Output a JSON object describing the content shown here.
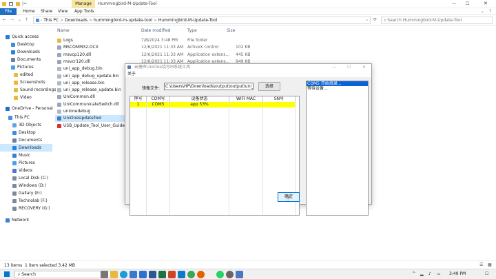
{
  "titlebar": {
    "ribbon_context": "Manage",
    "title": "Hummingbird-M-Update-Tool",
    "quick_access": "|="
  },
  "ribbon": {
    "tabs": [
      "File",
      "Home",
      "Share",
      "View",
      "App Tools"
    ]
  },
  "address": {
    "crumbs": [
      "This PC",
      ">",
      "Downloads",
      ">",
      "hummingbird-m-update-tool",
      ">",
      "Hummingbird-M-Update-Tool"
    ],
    "search_placeholder": "Search Hummingbird-M-Update-Tool"
  },
  "nav": {
    "items": [
      {
        "label": "Quick access",
        "icon": "star-icon",
        "color": "#2b7bd5"
      },
      {
        "label": "Desktop",
        "icon": "desktop-icon",
        "color": "#3a8ee6"
      },
      {
        "label": "Downloads",
        "icon": "download-icon",
        "color": "#2f7fd8"
      },
      {
        "label": "Documents",
        "icon": "documents-icon",
        "color": "#6e7f99"
      },
      {
        "label": "Pictures",
        "icon": "pictures-icon",
        "color": "#4aa0e8"
      },
      {
        "label": "edited",
        "icon": "folder-icon",
        "color": "#e8b93c"
      },
      {
        "label": "Screenshots",
        "icon": "folder-icon",
        "color": "#e8b93c"
      },
      {
        "label": "Sound recordings",
        "icon": "folder-icon",
        "color": "#e8b93c"
      },
      {
        "label": "Video",
        "icon": "folder-icon",
        "color": "#e8b93c"
      },
      {
        "label": "OneDrive - Personal",
        "icon": "cloud-icon",
        "color": "#1d6fd1"
      },
      {
        "label": "This PC",
        "icon": "computer-icon",
        "color": "#4a8fd8"
      },
      {
        "label": "3D Objects",
        "icon": "cube-icon",
        "color": "#5aa6e8"
      },
      {
        "label": "Desktop",
        "icon": "desktop-icon",
        "color": "#3a8ee6"
      },
      {
        "label": "Documents",
        "icon": "documents-icon",
        "color": "#6e7f99"
      },
      {
        "label": "Downloads",
        "icon": "download-icon",
        "color": "#2f7fd8"
      },
      {
        "label": "Music",
        "icon": "music-icon",
        "color": "#3a7fd0"
      },
      {
        "label": "Pictures",
        "icon": "pictures-icon",
        "color": "#4aa0e8"
      },
      {
        "label": "Videos",
        "icon": "video-icon",
        "color": "#5a6fd0"
      },
      {
        "label": "Local Disk (C:)",
        "icon": "drive-icon",
        "color": "#7c8aa0"
      },
      {
        "label": "Windows (D:)",
        "icon": "drive-icon",
        "color": "#7c8aa0"
      },
      {
        "label": "Gallary (E:)",
        "icon": "drive-icon",
        "color": "#7c8aa0"
      },
      {
        "label": "Technolab (F:)",
        "icon": "drive-icon",
        "color": "#7c8aa0"
      },
      {
        "label": "RECOVERY (G:)",
        "icon": "drive-icon",
        "color": "#7c8aa0"
      },
      {
        "label": "Network",
        "icon": "network-icon",
        "color": "#3a7fd0"
      }
    ]
  },
  "files": {
    "headers": {
      "name": "Name",
      "date": "Date modified",
      "type": "Type",
      "size": "Size"
    },
    "rows": [
      {
        "name": "Logs",
        "date": "7/8/2024 3:48 PM",
        "type": "File folder",
        "size": "",
        "icon": "folder-icon",
        "color": "#e8b93c"
      },
      {
        "name": "MSCOMM32.OCX",
        "date": "12/6/2021 11:33 AM",
        "type": "ActiveX control",
        "size": "102 KB",
        "icon": "file-icon",
        "color": "#9aa6b8"
      },
      {
        "name": "msvcp120.dll",
        "date": "12/6/2021 11:33 AM",
        "type": "Application extens...",
        "size": "445 KB",
        "icon": "dll-icon",
        "color": "#9aa6b8"
      },
      {
        "name": "msvcr120.dll",
        "date": "12/6/2021 11:33 AM",
        "type": "Application extens...",
        "size": "949 KB",
        "icon": "dll-icon",
        "color": "#9aa6b8"
      },
      {
        "name": "uni_app_debug.bin",
        "date": "",
        "type": "",
        "size": "",
        "icon": "file-icon",
        "color": "#b0b8c6"
      },
      {
        "name": "uni_app_debug_update.bin",
        "date": "",
        "type": "",
        "size": "",
        "icon": "file-icon",
        "color": "#b0b8c6"
      },
      {
        "name": "uni_app_release.bin",
        "date": "",
        "type": "",
        "size": "",
        "icon": "file-icon",
        "color": "#b0b8c6"
      },
      {
        "name": "uni_app_release_update.bin",
        "date": "",
        "type": "",
        "size": "",
        "icon": "file-icon",
        "color": "#b0b8c6"
      },
      {
        "name": "UniCommon.dll",
        "date": "",
        "type": "",
        "size": "",
        "icon": "dll-icon",
        "color": "#9aa6b8"
      },
      {
        "name": "UniCommunicateSwitch.dll",
        "date": "",
        "type": "",
        "size": "",
        "icon": "dll-icon",
        "color": "#9aa6b8"
      },
      {
        "name": "unionedebug",
        "date": "",
        "type": "",
        "size": "",
        "icon": "file-icon",
        "color": "#b0b8c6"
      },
      {
        "name": "UniOneUpdateTool",
        "date": "",
        "type": "",
        "size": "",
        "icon": "app-icon",
        "color": "#4a78c2"
      },
      {
        "name": "USB_Update_Tool_User_Guide",
        "date": "",
        "type": "",
        "size": "",
        "icon": "pdf-icon",
        "color": "#d8322e"
      }
    ]
  },
  "status": {
    "count": "13 items",
    "selected": "1 item selected  3.42 MB"
  },
  "dialog": {
    "title": "云捷声UniOne烧写M系统工具",
    "menu": "关于",
    "file_label": "镜像文件:",
    "file_value": "C:\\Users\\HP\\Downloads\\output\\output\\uni_app_rele",
    "browse": "选择",
    "grid_headers": [
      "序号",
      "COM号",
      "设备状态",
      "WIFI MAC",
      "SN号"
    ],
    "grid_row": [
      "1",
      "COM5",
      "app 53%",
      "",
      ""
    ],
    "log": [
      "COM5 开始烧录...",
      "等待设备..."
    ],
    "ok": "确定",
    "highlight": "#ffff00",
    "selection": "#0a64d8"
  },
  "taskbar": {
    "search": "Search",
    "time": "3:49 PM"
  }
}
